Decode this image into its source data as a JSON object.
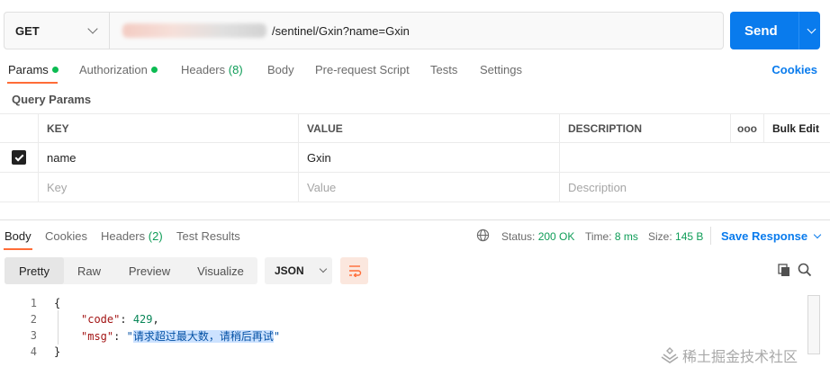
{
  "request": {
    "method": "GET",
    "url_visible": "/sentinel/Gxin?name=Gxin",
    "send_label": "Send"
  },
  "request_tabs": [
    {
      "label": "Params",
      "dot": true
    },
    {
      "label": "Authorization",
      "dot": true
    },
    {
      "label": "Headers",
      "count": "(8)"
    },
    {
      "label": "Body"
    },
    {
      "label": "Pre-request Script"
    },
    {
      "label": "Tests"
    },
    {
      "label": "Settings"
    }
  ],
  "cookies_label": "Cookies",
  "query_params": {
    "title": "Query Params",
    "headers": {
      "key": "KEY",
      "value": "VALUE",
      "description": "DESCRIPTION",
      "more": "ooo",
      "bulk_edit": "Bulk Edit"
    },
    "rows": [
      {
        "key": "name",
        "value": "Gxin",
        "description": "",
        "checked": true
      }
    ],
    "placeholders": {
      "key": "Key",
      "value": "Value",
      "description": "Description"
    }
  },
  "response": {
    "tabs": [
      {
        "label": "Body"
      },
      {
        "label": "Cookies"
      },
      {
        "label": "Headers",
        "count": "(2)"
      },
      {
        "label": "Test Results"
      }
    ],
    "status_label": "Status:",
    "status_value": "200 OK",
    "time_label": "Time:",
    "time_value": "8 ms",
    "size_label": "Size:",
    "size_value": "145 B",
    "save_label": "Save Response",
    "view_modes": [
      "Pretty",
      "Raw",
      "Preview",
      "Visualize"
    ],
    "format": "JSON",
    "code_lines": [
      {
        "n": "1",
        "text": "{"
      },
      {
        "n": "2",
        "key": "\"code\"",
        "val": "429",
        "suffix": ","
      },
      {
        "n": "3",
        "key": "\"msg\"",
        "val_open": "\"",
        "val_sel": "请求超过最大数，请稍后再试",
        "val_close": "\""
      },
      {
        "n": "4",
        "text": "}"
      }
    ]
  },
  "watermark": "稀土掘金技术社区",
  "colors": {
    "accent": "#ff6c37",
    "primary": "#097bed",
    "success": "#0cbb52"
  }
}
